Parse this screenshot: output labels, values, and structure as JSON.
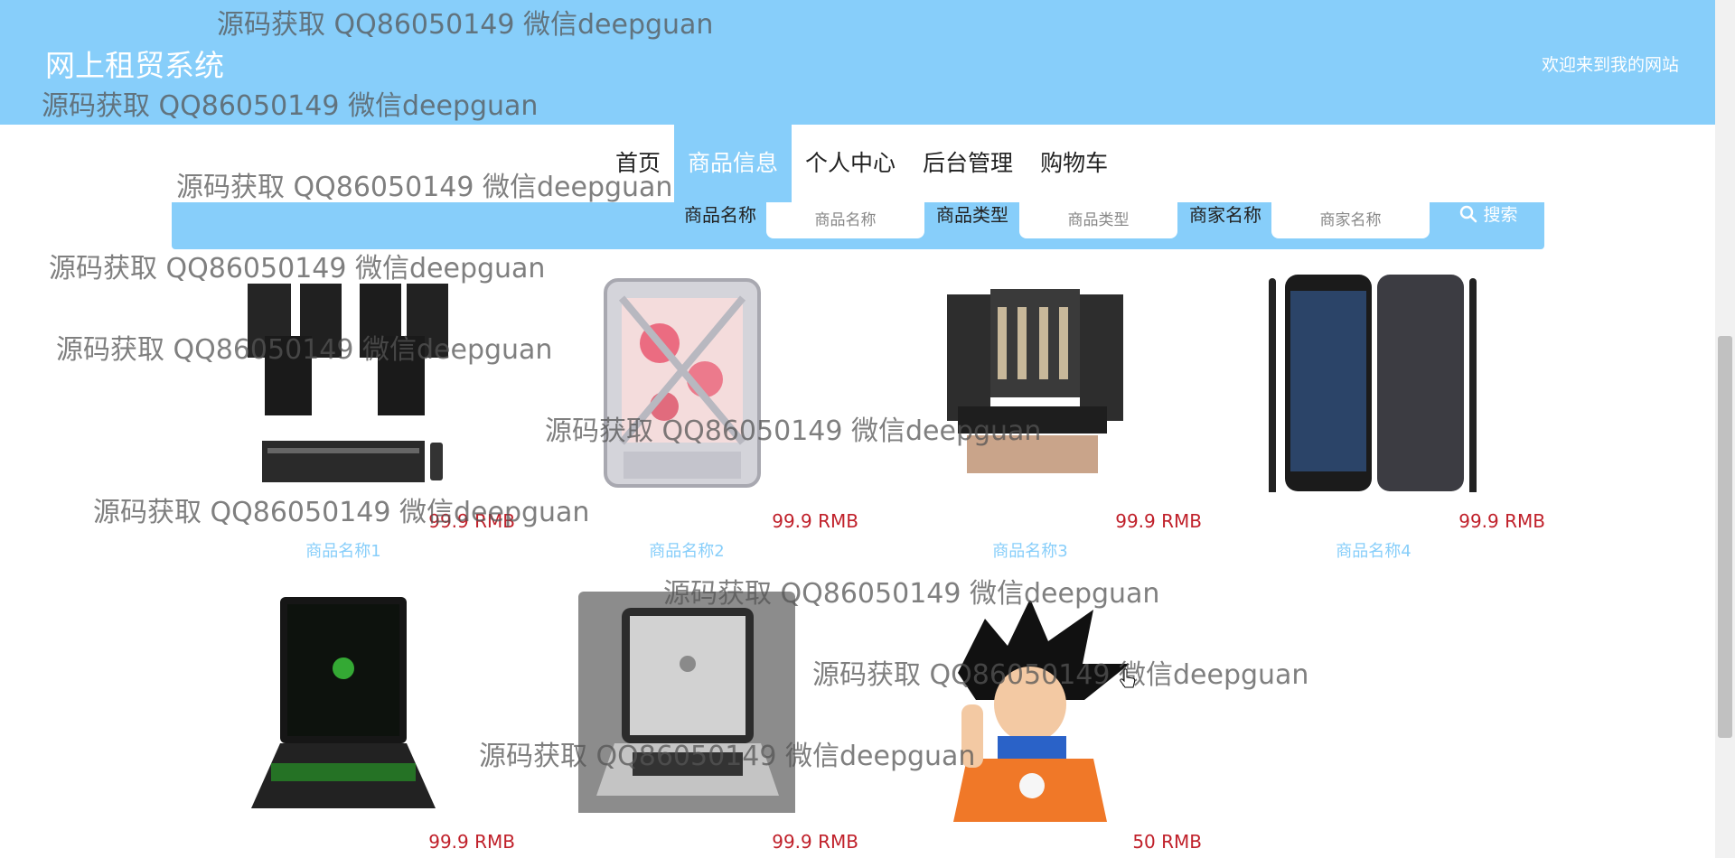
{
  "header": {
    "title": "网上租贸系统",
    "welcome": "欢迎来到我的网站"
  },
  "nav": {
    "items": [
      "首页",
      "商品信息",
      "个人中心",
      "后台管理",
      "购物车"
    ],
    "active": "商品信息"
  },
  "search": {
    "labels": [
      "商品名称",
      "商品类型",
      "商家名称"
    ],
    "placeholders": [
      "商品名称",
      "商品类型",
      "商家名称"
    ],
    "button": "搜索"
  },
  "products": [
    {
      "name": "商品名称1",
      "price": "99.9 RMB",
      "image": "speaker-set"
    },
    {
      "name": "商品名称2",
      "price": "99.9 RMB",
      "image": "pc-case"
    },
    {
      "name": "商品名称3",
      "price": "99.9 RMB",
      "image": "karaoke-speakers"
    },
    {
      "name": "商品名称4",
      "price": "99.9 RMB",
      "image": "smartphone"
    },
    {
      "name": "",
      "price": "99.9 RMB",
      "image": "gaming-laptop"
    },
    {
      "name": "",
      "price": "99.9 RMB",
      "image": "macbook"
    },
    {
      "name": "",
      "price": "50 RMB",
      "image": "anime-character"
    }
  ],
  "watermark": "源码获取 QQ86050149 微信deepguan",
  "colors": {
    "primary": "#87cefa",
    "price": "#c0202a"
  },
  "icons": {
    "search": "search-icon"
  }
}
